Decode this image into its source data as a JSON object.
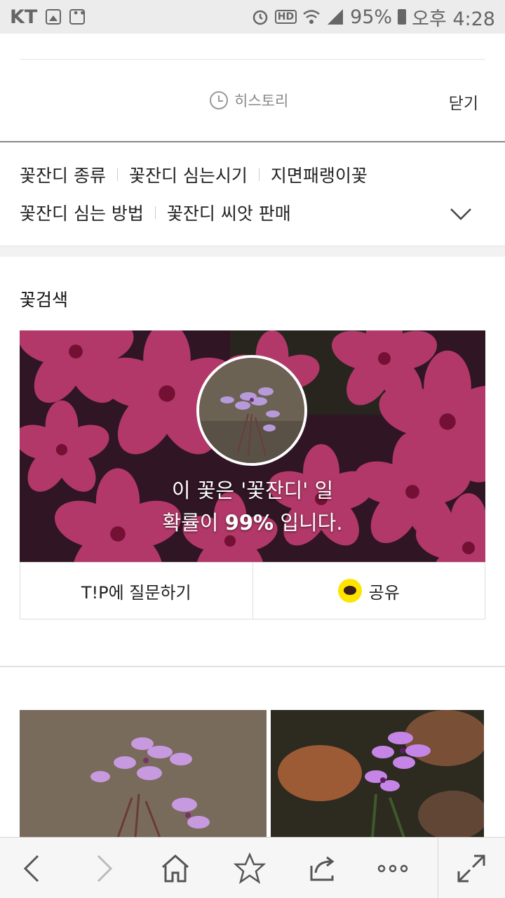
{
  "status": {
    "carrier": "KT",
    "battery": "95%",
    "time": "오후 4:28"
  },
  "history": {
    "label": "히스토리",
    "close_label": "닫기"
  },
  "related_keywords": [
    [
      "꽃잔디 종류",
      "꽃잔디 심는시기",
      "지면패랭이꽃"
    ],
    [
      "꽃잔디 심는 방법",
      "꽃잔디 씨앗 판매"
    ]
  ],
  "flower_search": {
    "title": "꽃검색",
    "result_prefix": "이 꽃은 '꽃잔디' 일",
    "prob_prefix": "확률이",
    "probability": "99%",
    "prob_suffix": "입니다.",
    "ask_label": "T!P에 질문하기",
    "share_label": "공유"
  },
  "toolbar": {
    "icons": [
      "back-icon",
      "forward-icon",
      "home-icon",
      "bookmark-icon",
      "tabs-icon",
      "more-icon",
      "fullscreen-icon"
    ]
  },
  "colors": {
    "hero_bg": "#5a1b3e",
    "petal": "#d8457f",
    "kakao": "#fde500"
  }
}
